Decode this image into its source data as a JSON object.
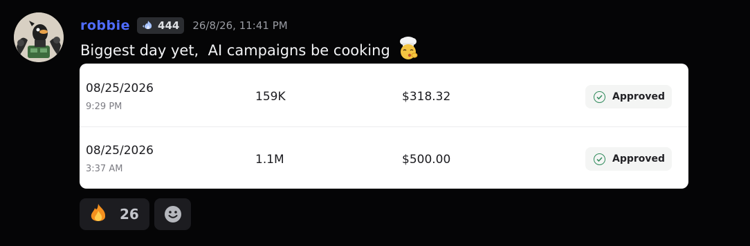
{
  "author": {
    "username": "robbie",
    "guild_tag_icon": "flame-badge-icon",
    "guild_tag_number": "444",
    "timestamp": "26/8/26, 11:41 PM"
  },
  "message": {
    "text": "Biggest day yet,  AI campaigns be cooking",
    "emoji": "chef-emoji-icon"
  },
  "payouts": [
    {
      "date": "08/25/2026",
      "time": "9:29 PM",
      "views": "159K",
      "amount": "$318.32",
      "status": "Approved"
    },
    {
      "date": "08/25/2026",
      "time": "3:37 AM",
      "views": "1.1M",
      "amount": "$500.00",
      "status": "Approved"
    }
  ],
  "reactions": [
    {
      "emoji": "fire-emoji-icon",
      "count": "26"
    }
  ],
  "add_reaction": {
    "icon": "smiley-add-reaction-icon"
  },
  "colors": {
    "username": "#4f6cff",
    "approved_check": "#2e8a5a",
    "background": "#050506"
  }
}
